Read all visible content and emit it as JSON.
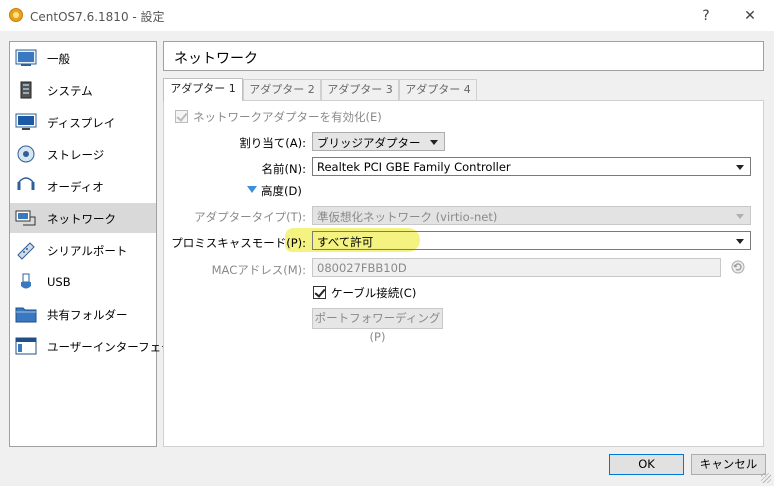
{
  "window": {
    "title": "CentOS7.6.1810 - 設定",
    "help": "?",
    "close": "✕"
  },
  "sidebar": {
    "items": [
      {
        "label": "一般",
        "icon": "general-icon"
      },
      {
        "label": "システム",
        "icon": "system-icon"
      },
      {
        "label": "ディスプレイ",
        "icon": "display-icon"
      },
      {
        "label": "ストレージ",
        "icon": "storage-icon"
      },
      {
        "label": "オーディオ",
        "icon": "audio-icon"
      },
      {
        "label": "ネットワーク",
        "icon": "network-icon",
        "selected": true
      },
      {
        "label": "シリアルポート",
        "icon": "serial-port-icon"
      },
      {
        "label": "USB",
        "icon": "usb-icon"
      },
      {
        "label": "共有フォルダー",
        "icon": "shared-folder-icon"
      },
      {
        "label": "ユーザーインターフェース",
        "icon": "user-interface-icon"
      }
    ]
  },
  "page": {
    "title": "ネットワーク"
  },
  "tabs": [
    "アダプター 1",
    "アダプター 2",
    "アダプター 3",
    "アダプター 4"
  ],
  "form": {
    "enable_label": "ネットワークアダプターを有効化(E)",
    "attached_label": "割り当て(A):",
    "attached_value": "ブリッジアダプター",
    "name_label": "名前(N):",
    "name_value": "Realtek PCI GBE Family Controller",
    "advanced_label": "高度(D)",
    "adapter_type_label": "アダプタータイプ(T):",
    "adapter_type_value": "準仮想化ネットワーク (virtio-net)",
    "promiscuous_label": "プロミスキャスモード(P):",
    "promiscuous_value": "すべて許可",
    "mac_label": "MACアドレス(M):",
    "mac_value": "080027FBB10D",
    "cable_label": "ケーブル接続(C)",
    "port_forwarding_label": "ポートフォワーディング(P)"
  },
  "footer": {
    "ok": "OK",
    "cancel": "キャンセル"
  },
  "colors": {
    "highlight": "#f2f06a",
    "selected_bg": "#d9d9d9",
    "accent": "#0078d7"
  }
}
